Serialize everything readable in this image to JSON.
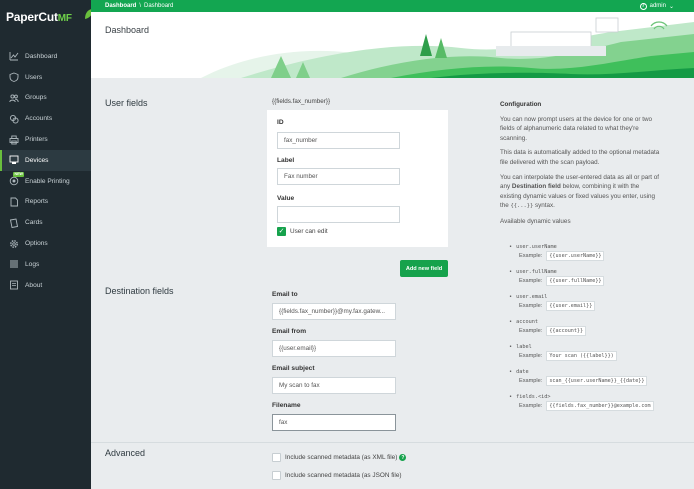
{
  "app": {
    "logo_text": "PaperCut",
    "logo_suffix": "MF"
  },
  "sidebar": {
    "items": [
      {
        "label": "Dashboard",
        "icon": "chart-line-icon"
      },
      {
        "label": "Users",
        "icon": "shield-user-icon"
      },
      {
        "label": "Groups",
        "icon": "users-icon"
      },
      {
        "label": "Accounts",
        "icon": "accounts-icon"
      },
      {
        "label": "Printers",
        "icon": "printer-icon"
      },
      {
        "label": "Devices",
        "icon": "device-icon",
        "active": true
      },
      {
        "label": "Enable Printing",
        "icon": "enable-printing-icon",
        "badge": "NEW"
      },
      {
        "label": "Reports",
        "icon": "document-icon"
      },
      {
        "label": "Cards",
        "icon": "card-icon"
      },
      {
        "label": "Options",
        "icon": "gear-icon"
      },
      {
        "label": "Logs",
        "icon": "list-icon"
      },
      {
        "label": "About",
        "icon": "about-icon"
      }
    ]
  },
  "topbar": {
    "breadcrumb_1": "Dashboard",
    "breadcrumb_sep": "\\",
    "breadcrumb_2": "Dashboard",
    "user": "admin",
    "user_caret": "⌄"
  },
  "header": {
    "title": "Dashboard"
  },
  "user_fields": {
    "title": "User fields",
    "field_ref": "{{fields.fax_number}}",
    "id_label": "ID",
    "id_value": "fax_number",
    "label_label": "Label",
    "label_value": "Fax number",
    "value_label": "Value",
    "value_value": "",
    "user_can_edit_label": "User can edit",
    "user_can_edit_checked": true,
    "add_button": "Add new field"
  },
  "destination_fields": {
    "title": "Destination fields",
    "email_to_label": "Email to",
    "email_to_value": "{{fields.fax_number}}@my.fax.gatew...",
    "email_from_label": "Email from",
    "email_from_value": "{{user.email}}",
    "email_subject_label": "Email subject",
    "email_subject_value": "My scan to fax",
    "filename_label": "Filename",
    "filename_value": "fax"
  },
  "advanced": {
    "title": "Advanced",
    "xml_label": "Include scanned metadata (as XML file)",
    "json_label": "Include scanned metadata (as JSON file)",
    "help": "?"
  },
  "config": {
    "heading": "Configuration",
    "p1": "You can now prompt users at the device for one or two fields of alphanumeric data related to what they're scanning.",
    "p2": "This data is automatically added to the optional metadata file delivered with the scan payload.",
    "p3_a": "You can interpolate the user-entered data as all or part of any ",
    "p3_b": "Destination field",
    "p3_c": " below, combining it with the existing dynamic values or fixed values you enter, using the ",
    "p3_code": "{{...}}",
    "p3_d": " syntax.",
    "available": "Available dynamic values",
    "example_label": "Example:",
    "vars": [
      {
        "name": "user.userName",
        "example": "{{user.userName}}"
      },
      {
        "name": "user.fullName",
        "example": "{{user.fullName}}"
      },
      {
        "name": "user.email",
        "example": "{{user.email}}"
      },
      {
        "name": "account",
        "example": "{{account}}"
      },
      {
        "name": "label",
        "example": "Your scan ({{label}})"
      },
      {
        "name": "date",
        "example": "scan_{{user.userName}}_{{date}}"
      },
      {
        "name": "fields.<id>",
        "example": "{{fields.fax_number}}@example.com"
      }
    ]
  },
  "colors": {
    "brand_green": "#13a651",
    "sidebar_bg": "#1f2a30",
    "content_bg": "#e9ecee"
  }
}
